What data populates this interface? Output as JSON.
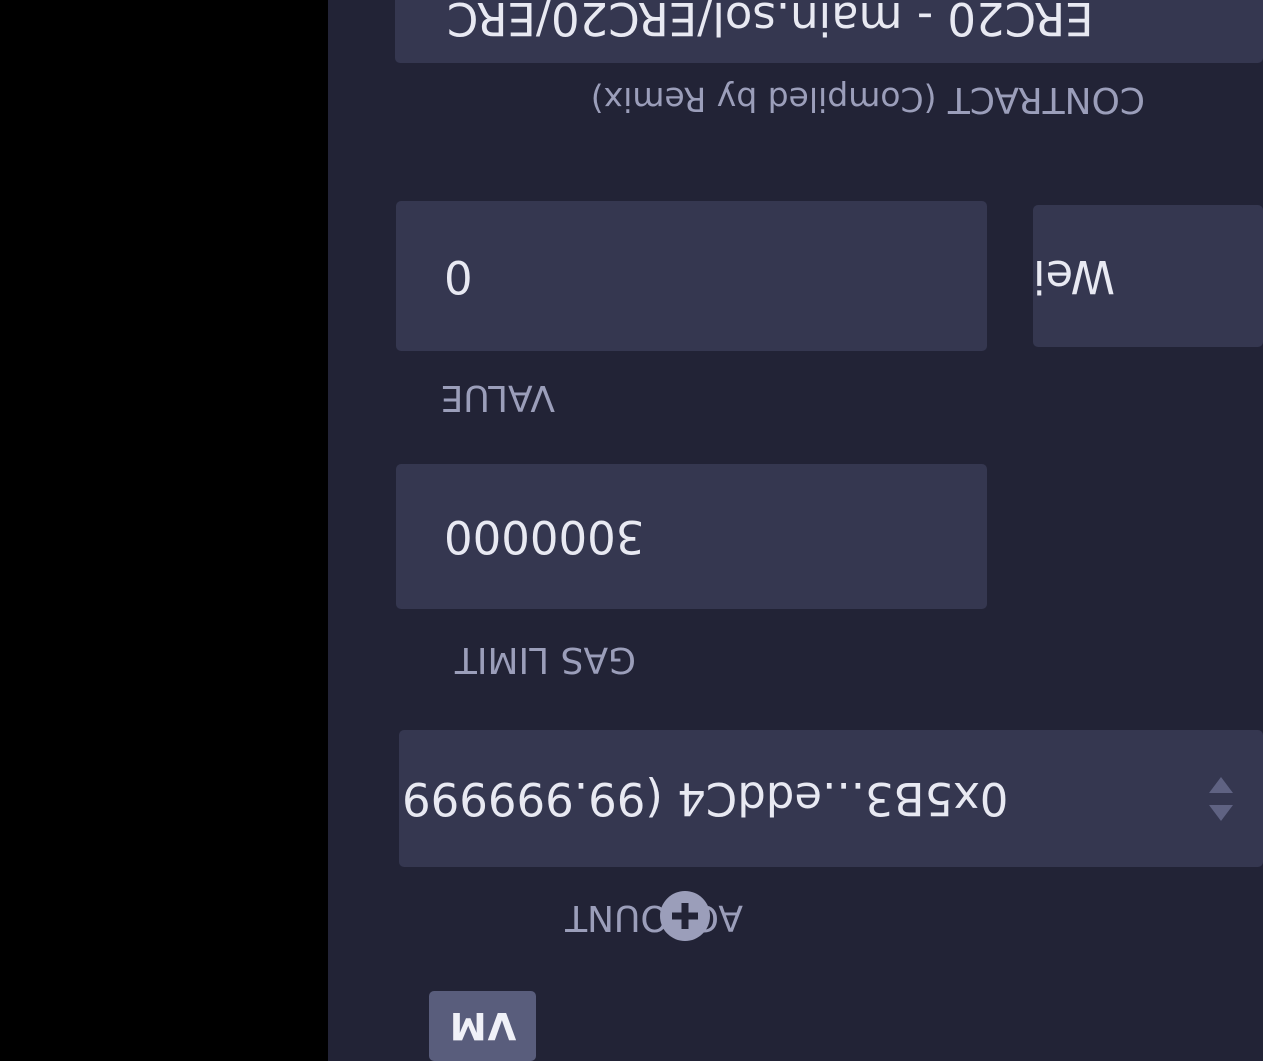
{
  "environment": {
    "badge": "VM"
  },
  "account": {
    "label": "ACCOUNT",
    "add_icon": "plus-circle-icon",
    "selected": "0x5B3...eddC4 (99.999999"
  },
  "gas_limit": {
    "label": "GAS LIMIT",
    "value": "3000000"
  },
  "value": {
    "label": "VALUE",
    "amount": "0",
    "unit": "Wei"
  },
  "contract": {
    "label": "CONTRACT",
    "sublabel": "(Compiled by Remix)",
    "selected": "ERC20 - main.sol/ERC20/ERC"
  },
  "colors": {
    "panel_bg": "#222336",
    "field_bg": "#353750",
    "label_text": "#9b9eba",
    "badge_bg": "#595d7c"
  }
}
